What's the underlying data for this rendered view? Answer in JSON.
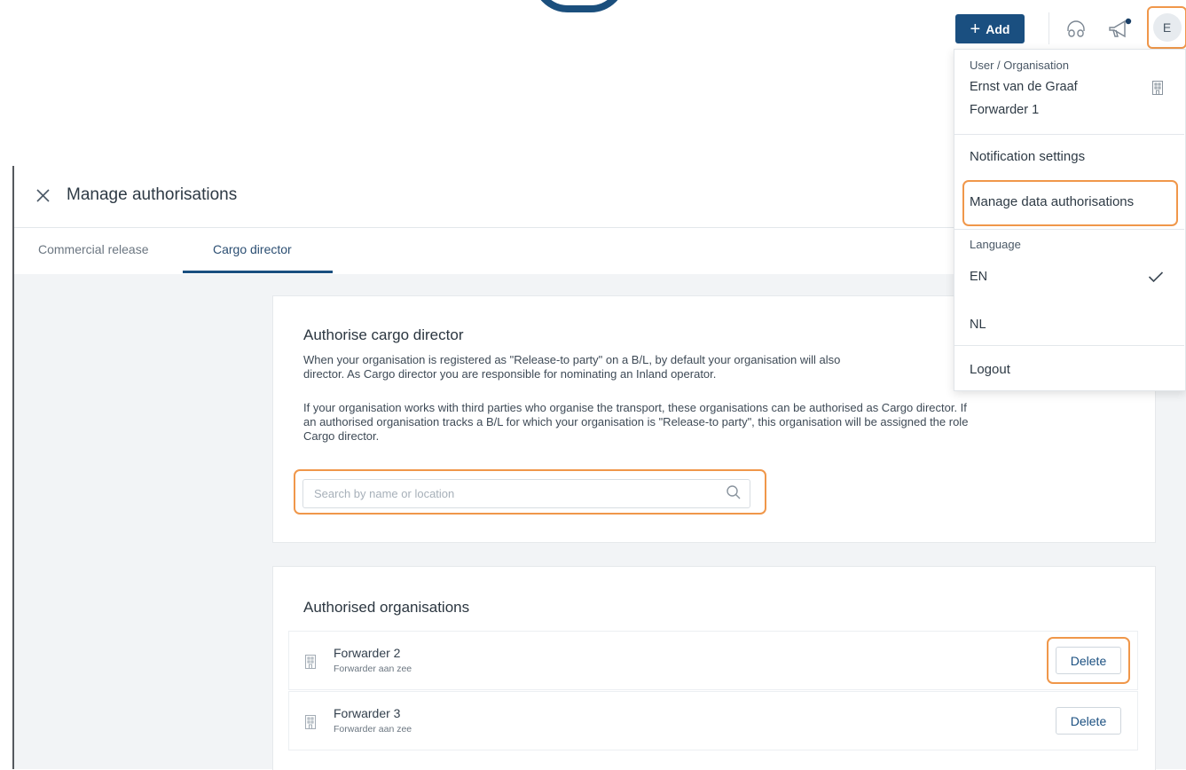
{
  "header": {
    "add_label": "Add",
    "support_icon": "headset-icon",
    "announce_icon": "megaphone-icon",
    "avatar_initial": "E"
  },
  "page": {
    "title": "Manage authorisations",
    "tabs": [
      {
        "label": "Commercial release",
        "active": false
      },
      {
        "label": "Cargo director",
        "active": true
      }
    ]
  },
  "authorise": {
    "heading": "Authorise cargo director",
    "para1_line1": "When your organisation is registered as \"Release-to party\" on a B/L, by default your organisation will also",
    "para1_line2": "director. As Cargo director you are responsible for nominating an Inland operator.",
    "para2_line1": "If your organisation works with third parties who organise the transport, these organisations can be authorised as Cargo director. If",
    "para2_line2": "an authorised organisation tracks a B/L for which your organisation is \"Release-to party\", this organisation will be assigned the role",
    "para2_line3": "Cargo director.",
    "search_placeholder": "Search by name or location"
  },
  "authorised": {
    "heading": "Authorised organisations",
    "orgs": [
      {
        "name": "Forwarder 2",
        "location": "Forwarder aan zee",
        "action": "Delete"
      },
      {
        "name": "Forwarder 3",
        "location": "Forwarder aan zee",
        "action": "Delete"
      }
    ]
  },
  "menu": {
    "section_label": "User / Organisation",
    "user_name": "Ernst van de Graaf",
    "org_name": "Forwarder 1",
    "notification_settings": "Notification settings",
    "manage_data_auth": "Manage data authorisations",
    "language_label": "Language",
    "lang_en": "EN",
    "lang_nl": "NL",
    "logout": "Logout"
  },
  "colors": {
    "accent": "#1a4f80",
    "highlight": "#f0974a",
    "background": "#f2f4f6"
  }
}
